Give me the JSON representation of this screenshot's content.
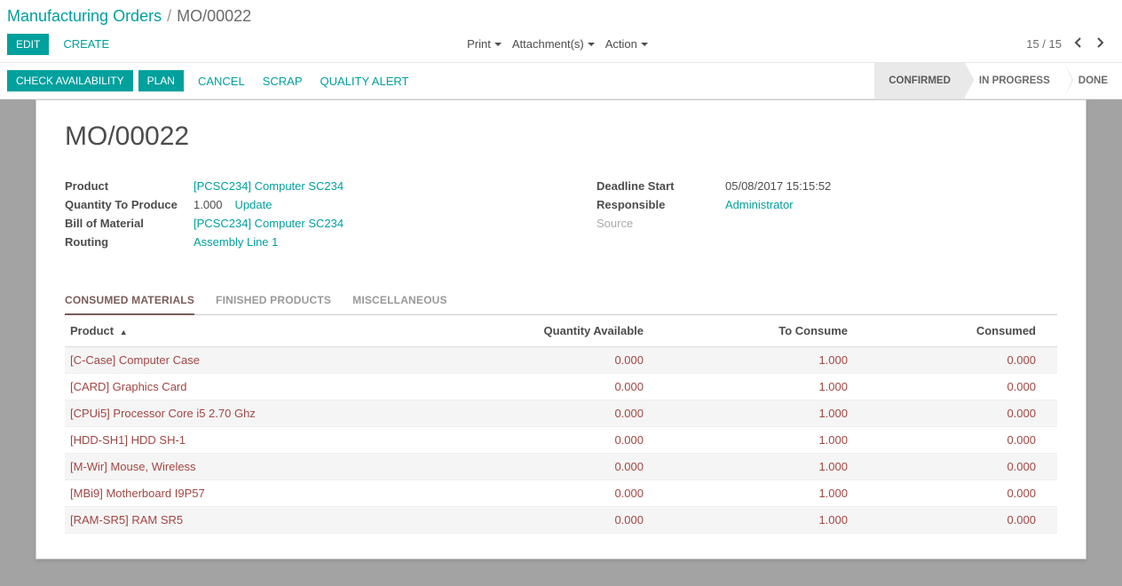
{
  "breadcrumb": {
    "root": "Manufacturing Orders",
    "sep": "/",
    "current": "MO/00022"
  },
  "controls": {
    "edit": "EDIT",
    "create": "CREATE",
    "print": "Print",
    "attachments": "Attachment(s)",
    "action": "Action",
    "pager": "15 / 15"
  },
  "actions": {
    "check": "CHECK AVAILABILITY",
    "plan": "PLAN",
    "cancel": "CANCEL",
    "scrap": "SCRAP",
    "quality": "QUALITY ALERT"
  },
  "status": {
    "confirmed": "CONFIRMED",
    "in_progress": "IN PROGRESS",
    "done": "DONE"
  },
  "sheet": {
    "title": "MO/00022",
    "labels": {
      "product": "Product",
      "qty": "Quantity To Produce",
      "bom": "Bill of Material",
      "routing": "Routing",
      "deadline": "Deadline Start",
      "responsible": "Responsible",
      "source": "Source"
    },
    "values": {
      "product": "[PCSC234] Computer SC234",
      "qty": "1.000",
      "update": "Update",
      "bom": "[PCSC234] Computer SC234",
      "routing": "Assembly Line 1",
      "deadline": "05/08/2017 15:15:52",
      "responsible": "Administrator",
      "source": ""
    }
  },
  "tabs": {
    "consumed": "CONSUMED MATERIALS",
    "finished": "FINISHED PRODUCTS",
    "misc": "MISCELLANEOUS"
  },
  "table": {
    "headers": {
      "product": "Product",
      "qty_avail": "Quantity Available",
      "to_consume": "To Consume",
      "consumed": "Consumed"
    },
    "rows": [
      {
        "product": "[C-Case] Computer Case",
        "qty_avail": "0.000",
        "to_consume": "1.000",
        "consumed": "0.000"
      },
      {
        "product": "[CARD] Graphics Card",
        "qty_avail": "0.000",
        "to_consume": "1.000",
        "consumed": "0.000"
      },
      {
        "product": "[CPUi5] Processor Core i5 2.70 Ghz",
        "qty_avail": "0.000",
        "to_consume": "1.000",
        "consumed": "0.000"
      },
      {
        "product": "[HDD-SH1] HDD SH-1",
        "qty_avail": "0.000",
        "to_consume": "1.000",
        "consumed": "0.000"
      },
      {
        "product": "[M-Wir] Mouse, Wireless",
        "qty_avail": "0.000",
        "to_consume": "1.000",
        "consumed": "0.000"
      },
      {
        "product": "[MBi9] Motherboard I9P57",
        "qty_avail": "0.000",
        "to_consume": "1.000",
        "consumed": "0.000"
      },
      {
        "product": "[RAM-SR5] RAM SR5",
        "qty_avail": "0.000",
        "to_consume": "1.000",
        "consumed": "0.000"
      }
    ]
  }
}
